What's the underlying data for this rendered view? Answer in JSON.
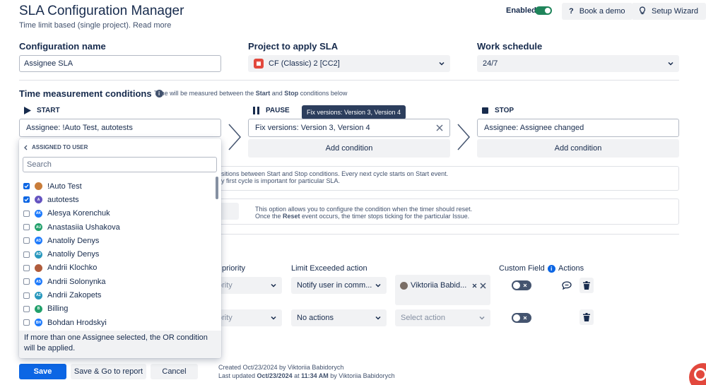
{
  "header": {
    "title": "SLA Configuration Manager",
    "subtitle": "Time limit based (single project).",
    "read_more": "Read more",
    "enabled_label": "Enabled",
    "book_demo": "Book a demo",
    "setup_wizard": "Setup Wizard",
    "enabled": true
  },
  "config": {
    "name_label": "Configuration name",
    "name_value": "Assignee SLA",
    "project_label": "Project to apply SLA",
    "project_value": "CF (Classic) 2 [CC2]",
    "schedule_label": "Work schedule",
    "schedule_value": "24/7"
  },
  "measure": {
    "title": "Time measurement conditions",
    "note_pre": "Time will be measured between the ",
    "note_start": "Start",
    "note_mid": " and ",
    "note_stop": "Stop",
    "note_post": " conditions below",
    "start_label": "START",
    "pause_label": "PAUSE",
    "stop_label": "STOP",
    "start_condition": "Assignee: !Auto Test, autotests",
    "pause_condition": "Fix versions: Version 3, Version 4",
    "stop_condition": "Assignee: Assignee changed",
    "add_condition": "Add condition",
    "tooltip": "Fix versions: Version 3, Version 4"
  },
  "info": {
    "cycles_line1": "sitions between Start and Stop conditions. Every next cycle starts on Start event.",
    "cycles_line2": "y first cycle is important for particular SLA.",
    "reset_line1": "This option allows you to configure the condition when the timer should reset.",
    "reset_line2_pre": "Once the ",
    "reset_word": "Reset",
    "reset_line2_post": " event occurs, the timer stops ticking for the particular Issue."
  },
  "table": {
    "priority_header": "priority",
    "limit_header": "Limit Exceeded action",
    "custom_field_header": "Custom Field",
    "actions_header": "Actions",
    "rows": [
      {
        "priority": "ority",
        "action": "Notify user in comm...",
        "target": "Viktoriia Babid...",
        "custom_field_on": false
      },
      {
        "priority": "ority",
        "action": "No actions",
        "target_placeholder": "Select action",
        "custom_field_on": false
      }
    ]
  },
  "dropdown": {
    "heading": "ASSIGNED TO USER",
    "search_placeholder": "Search",
    "users": [
      {
        "name": "!Auto Test",
        "checked": true,
        "initials": "",
        "color": "#c97d3a"
      },
      {
        "name": "autotests",
        "checked": true,
        "initials": "A",
        "color": "#6554c0"
      },
      {
        "name": "Alesya Korenchuk",
        "checked": false,
        "initials": "AK",
        "color": "#1d7afc"
      },
      {
        "name": "Anastasiia Ushakova",
        "checked": false,
        "initials": "AU",
        "color": "#22a06b"
      },
      {
        "name": "Anatoliy Denys",
        "checked": false,
        "initials": "AD",
        "color": "#1d7afc"
      },
      {
        "name": "Anatoliy Denys",
        "checked": false,
        "initials": "AD",
        "color": "#2898bd"
      },
      {
        "name": "Andrii Klochko",
        "checked": false,
        "initials": "",
        "color": "#b05c3c"
      },
      {
        "name": "Andrii Solonynka",
        "checked": false,
        "initials": "AS",
        "color": "#1d7afc"
      },
      {
        "name": "Andrii Zakopets",
        "checked": false,
        "initials": "AZ",
        "color": "#2898bd"
      },
      {
        "name": "Billing",
        "checked": false,
        "initials": "B",
        "color": "#22a06b"
      },
      {
        "name": "Bohdan Hrodskyi",
        "checked": false,
        "initials": "BH",
        "color": "#1d7afc"
      }
    ],
    "footer": "If more than one Assignee selected, the OR condition will be applied."
  },
  "footer": {
    "save": "Save",
    "save_report": "Save & Go to report",
    "cancel": "Cancel",
    "created": "Created Oct/23/2024 by Viktoriia Babidorych",
    "updated_pre": "Last updated ",
    "updated_when": "Oct/23/2024",
    "updated_mid": " at ",
    "updated_time": "11:34 AM",
    "updated_post": " by Viktoriia Babidorych"
  },
  "colors": {
    "primary": "#0c66e4",
    "toggle_on": "#1f845a",
    "tooltip_bg": "#2c3e5d"
  }
}
